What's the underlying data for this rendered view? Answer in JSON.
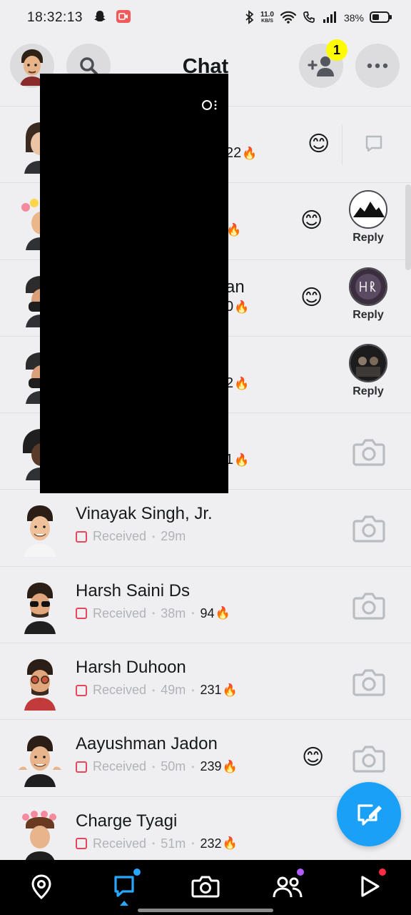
{
  "status_bar": {
    "time": "18:32:13",
    "net_speed_value": "11.0",
    "net_speed_unit": "KB/S",
    "battery": "38%"
  },
  "header": {
    "title": "Chat",
    "add_friend_badge": "1"
  },
  "redacted_partial_text": {
    "row1_streak_suffix": "22",
    "row2_streak_suffix": "",
    "row3_name_suffix": "an",
    "row3_streak_suffix": "0",
    "row4_streak_suffix": "2",
    "row5_streak_suffix": "1"
  },
  "reply_label": "Reply",
  "chats": [
    {
      "name": "Vinayak Singh, Jr.",
      "status": "Received",
      "time": "29m",
      "streak": ""
    },
    {
      "name": "Harsh Saini Ds",
      "status": "Received",
      "time": "38m",
      "streak": "94"
    },
    {
      "name": "Harsh Duhoon",
      "status": "Received",
      "time": "49m",
      "streak": "231"
    },
    {
      "name": "Aayushman Jadon",
      "status": "Received",
      "time": "50m",
      "streak": "239"
    },
    {
      "name": "Charge Tyagi",
      "status": "Received",
      "time": "51m",
      "streak": "232"
    }
  ],
  "icons": {
    "emoji_smile": "😊",
    "fire": "🔥"
  },
  "colors": {
    "brand_blue": "#1aa1f7",
    "badge_yellow": "#fffc00",
    "received_red": "#e6475c",
    "nav_chat_dot": "#27a7ff",
    "nav_stories_dot": "#b05cff",
    "nav_spotlight_dot": "#ff2b45"
  }
}
